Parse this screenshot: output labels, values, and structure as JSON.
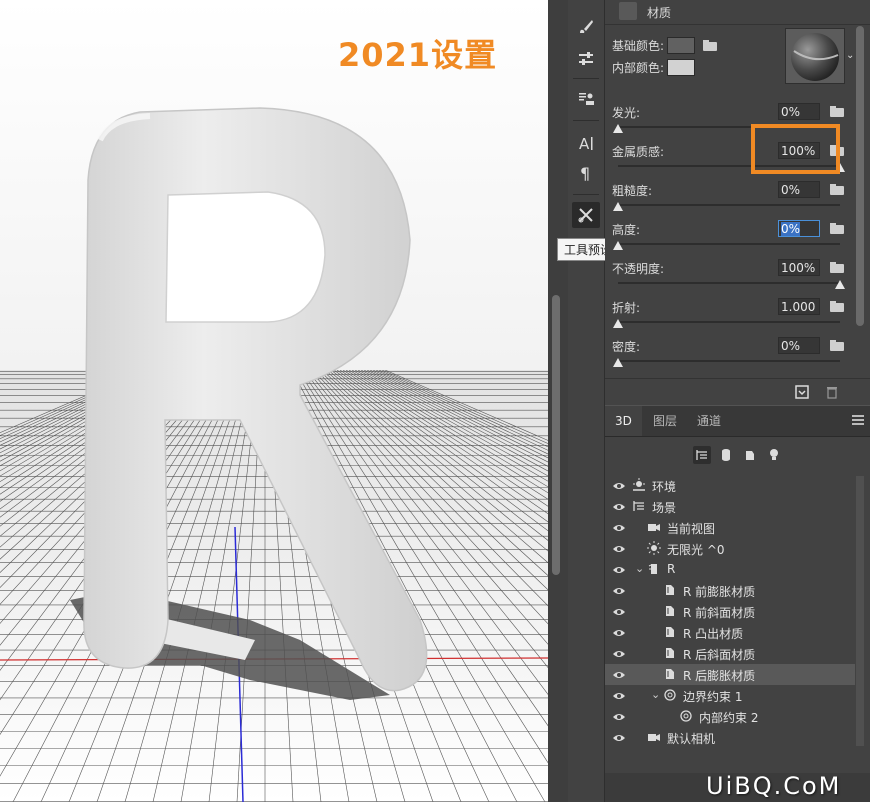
{
  "overlay_title": "2021设置",
  "watermark": "UiBQ.CoM",
  "tooltip": "工具预设",
  "properties": {
    "title": "材质",
    "base_color_label": "基础颜色:",
    "inner_color_label": "内部颜色:",
    "base_color": "#616161",
    "inner_color": "#d2d2d2",
    "params": [
      {
        "label": "发光:",
        "value": "0%",
        "slider": 0.0
      },
      {
        "label": "金属质感:",
        "value": "100%",
        "slider": 1.0
      },
      {
        "label": "粗糙度:",
        "value": "0%",
        "slider": 0.0
      },
      {
        "label": "高度:",
        "value": "0%",
        "slider": 0.0,
        "selected": true
      },
      {
        "label": "不透明度:",
        "value": "100%",
        "slider": 1.0
      },
      {
        "label": "折射:",
        "value": "1.000",
        "slider": 0.0
      },
      {
        "label": "密度:",
        "value": "0%",
        "slider": 0.0
      }
    ]
  },
  "layers_panel": {
    "tabs": [
      "3D",
      "图层",
      "通道"
    ],
    "active_tab": "3D",
    "filter_icons": [
      "scene-filter-icon",
      "mesh-filter-icon",
      "material-filter-icon",
      "light-filter-icon"
    ],
    "tree": [
      {
        "label": "环境",
        "icon": "environment-icon",
        "indent": 0
      },
      {
        "label": "场景",
        "icon": "scene-icon",
        "indent": 0
      },
      {
        "label": "当前视图",
        "icon": "camera-icon",
        "indent": 1
      },
      {
        "label": "无限光 ^0",
        "icon": "sun-icon",
        "indent": 1
      },
      {
        "label": "R",
        "icon": "mesh-icon",
        "indent": 1,
        "expanded": true
      },
      {
        "label": "R 前膨胀材质",
        "icon": "material-icon",
        "indent": 2
      },
      {
        "label": "R 前斜面材质",
        "icon": "material-icon",
        "indent": 2
      },
      {
        "label": "R 凸出材质",
        "icon": "material-icon",
        "indent": 2
      },
      {
        "label": "R 后斜面材质",
        "icon": "material-icon",
        "indent": 2
      },
      {
        "label": "R 后膨胀材质",
        "icon": "material-icon",
        "indent": 2,
        "selected": true
      },
      {
        "label": "边界约束 1",
        "icon": "constraint-icon",
        "indent": 2,
        "expanded": true
      },
      {
        "label": "内部约束 2",
        "icon": "constraint-icon",
        "indent": 3
      },
      {
        "label": "默认相机",
        "icon": "camera-icon",
        "indent": 1
      }
    ]
  },
  "colors": {
    "accent_highlight": "#f08a24",
    "selection_blue": "#3a72c4"
  }
}
